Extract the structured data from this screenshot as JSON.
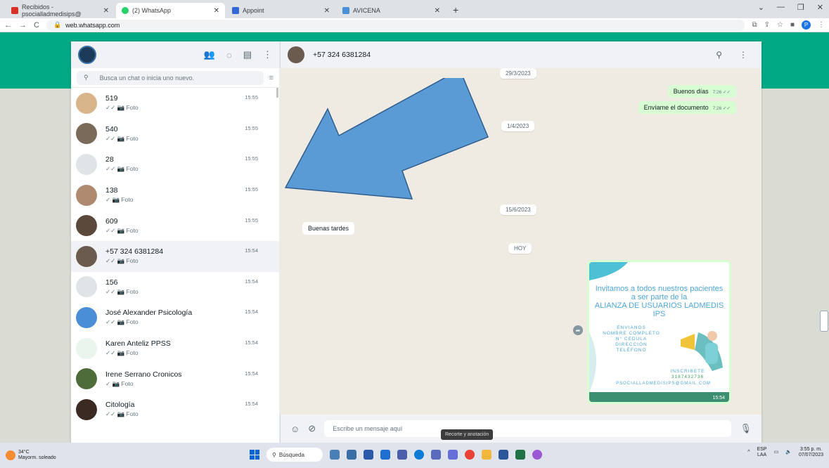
{
  "browser": {
    "tabs": [
      {
        "title": "Recibidos - psocialladmedisips@",
        "color": "#d93025"
      },
      {
        "title": "(2) WhatsApp",
        "color": "#25d366"
      },
      {
        "title": "Appoint",
        "color": "#3367d6"
      },
      {
        "title": "AVICENA",
        "color": "#4a90d9"
      }
    ],
    "new_tab": "+",
    "url": "web.whatsapp.com"
  },
  "sidebar": {
    "search_placeholder": "Busca un chat o inicia uno nuevo.",
    "chats": [
      {
        "name": "519",
        "time": "15:55",
        "last": "✓✓ 📷 Foto",
        "avatar_color": "#d8b48a"
      },
      {
        "name": "540",
        "time": "15:55",
        "last": "✓✓ 📷 Foto",
        "avatar_color": "#7a6a5a"
      },
      {
        "name": "28",
        "time": "15:55",
        "last": "✓✓ 📷 Foto",
        "avatar_color": "#dfe5e7"
      },
      {
        "name": "138",
        "time": "15:55",
        "last": "✓ 📷 Foto",
        "avatar_color": "#b08a70"
      },
      {
        "name": "609",
        "time": "15:55",
        "last": "✓✓ 📷 Foto",
        "avatar_color": "#5b4a3c"
      },
      {
        "name": "+57 324 6381284",
        "time": "15:54",
        "last": "✓✓ 📷 Foto",
        "avatar_color": "#6b5a4e"
      },
      {
        "name": "156",
        "time": "15:54",
        "last": "✓✓ 📷 Foto",
        "avatar_color": "#dfe5e7"
      },
      {
        "name": "José Alexander Psicología",
        "time": "15:54",
        "last": "✓✓ 📷 Foto",
        "avatar_color": "#4a8fd6"
      },
      {
        "name": "Karen Anteliz PPSS",
        "time": "15:54",
        "last": "✓✓ 📷 Foto",
        "avatar_color": "#e8f4ec"
      },
      {
        "name": "Irene Serrano Cronicos",
        "time": "15:54",
        "last": "✓ 📷 Foto",
        "avatar_color": "#4e6b3a"
      },
      {
        "name": "Citología",
        "time": "15:54",
        "last": "✓✓ 📷 Foto",
        "avatar_color": "#3b2a22"
      }
    ]
  },
  "conversation": {
    "contact": "+57 324 6381284",
    "dates": [
      "29/3/2023",
      "1/4/2023",
      "15/6/2023",
      "HOY"
    ],
    "messages_out": [
      {
        "text": "Buenos días",
        "time": "7:26 ✓✓"
      },
      {
        "text": "Envíame el documento",
        "time": "7:26 ✓✓"
      }
    ],
    "messages_in": [
      {
        "text": "Buenas tardes"
      }
    ],
    "flyer": {
      "title_lines": [
        "Invitamos a todos nuestros pacientes",
        "a ser parte de la",
        "ALIANZA DE USUARIOS LADMEDIS IPS"
      ],
      "send_lines": [
        "ENVIANOS",
        "NOMBRE COMPLETO",
        "N° CEDULA",
        "DIRECCIÓN",
        "TELÉFONO"
      ],
      "cta": "INSCRIBETE",
      "phone": "3187432736",
      "email": "PSOCIALLADMEDISIPS@GMAIL.COM",
      "time": "15:54"
    },
    "input_placeholder": "Escribe un mensaje aquí"
  },
  "tooltip": "Recorte y anotación",
  "taskbar": {
    "temp": "34°C",
    "weather": "Mayorm. soleado",
    "search": "Búsqueda",
    "lang": "ESP",
    "lang2": "LAA",
    "time": "3:55 p. m.",
    "date": "07/07/2023"
  },
  "colors": {
    "wa_green": "#00a884",
    "arrow": "#5b9bd5",
    "bubble_out": "#d9fdd3"
  }
}
